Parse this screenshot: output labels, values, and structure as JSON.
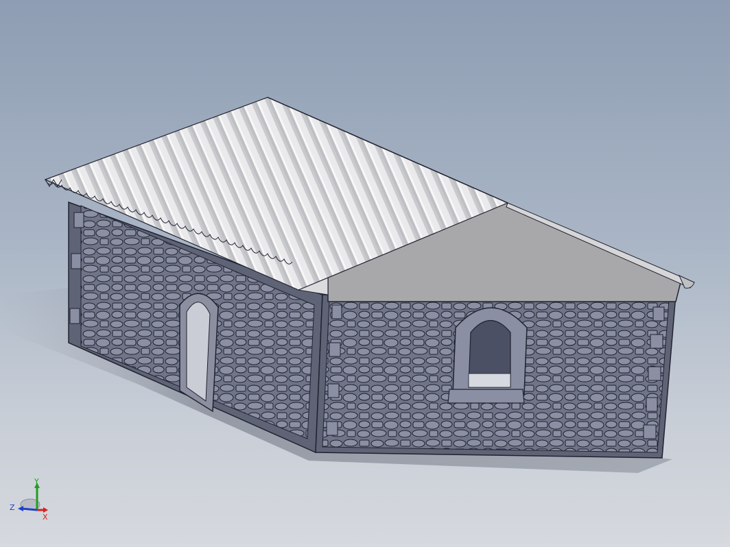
{
  "viewport": {
    "background_top": "#8e9db3",
    "background_bottom": "#d6d9de"
  },
  "model": {
    "wall_color": "#6f7488",
    "stone_color": "#8a8fa3",
    "roof_color": "#e6e6e8",
    "gable_color": "#a8a8aa"
  },
  "triad": {
    "x_label": "X",
    "y_label": "Y",
    "z_label": "Z",
    "x_color": "#d62020",
    "y_color": "#1fa01f",
    "z_color": "#2040c8"
  }
}
